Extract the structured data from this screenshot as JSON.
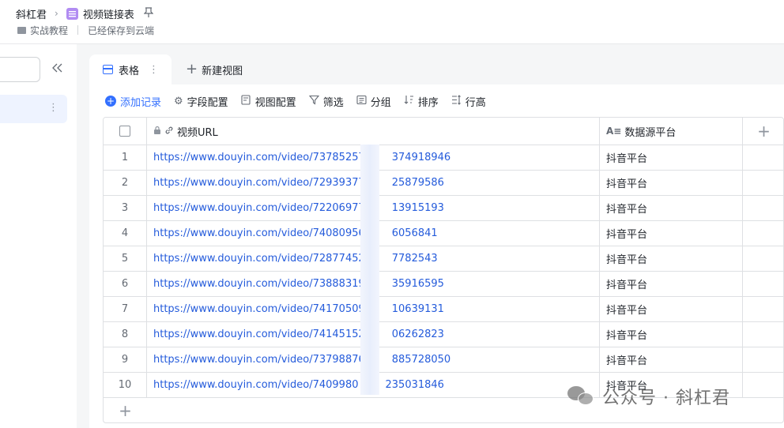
{
  "breadcrumb": {
    "root": "斜杠君",
    "doc": "视频链接表",
    "folder": "实战教程",
    "save_status": "已经保存到云端"
  },
  "tabs": {
    "active": "表格",
    "new_view": "新建视图"
  },
  "toolbar": {
    "add_record": "添加记录",
    "field_config": "字段配置",
    "view_config": "视图配置",
    "filter": "筛选",
    "group": "分组",
    "sort": "排序",
    "row_height": "行高"
  },
  "table": {
    "columns": {
      "url": "视频URL",
      "platform": "数据源平台"
    },
    "rows": [
      {
        "index": "1",
        "url": "https://www.douyin.com/video/73785257",
        "url_tail": "374918946",
        "platform": "抖音平台"
      },
      {
        "index": "2",
        "url": "https://www.douyin.com/video/72939377",
        "url_tail": "25879586",
        "platform": "抖音平台"
      },
      {
        "index": "3",
        "url": "https://www.douyin.com/video/72206977",
        "url_tail": "13915193",
        "platform": "抖音平台"
      },
      {
        "index": "4",
        "url": "https://www.douyin.com/video/74080956",
        "url_tail": "6056841",
        "platform": "抖音平台"
      },
      {
        "index": "5",
        "url": "https://www.douyin.com/video/72877452",
        "url_tail": "7782543",
        "platform": "抖音平台"
      },
      {
        "index": "6",
        "url": "https://www.douyin.com/video/73888319",
        "url_tail": "35916595",
        "platform": "抖音平台"
      },
      {
        "index": "7",
        "url": "https://www.douyin.com/video/74170509",
        "url_tail": "10639131",
        "platform": "抖音平台"
      },
      {
        "index": "8",
        "url": "https://www.douyin.com/video/74145152",
        "url_tail": "06262823",
        "platform": "抖音平台"
      },
      {
        "index": "9",
        "url": "https://www.douyin.com/video/73798876",
        "url_tail": "885728050",
        "platform": "抖音平台"
      },
      {
        "index": "10",
        "url": "https://www.douyin.com/video/7409980",
        "url_tail": "235031846",
        "platform": "抖音平台"
      }
    ]
  },
  "watermark": "公众号 · 斜杠君",
  "colors": {
    "accent": "#3370ff",
    "link": "#245bdb",
    "table_icon": "#b18cf2"
  }
}
